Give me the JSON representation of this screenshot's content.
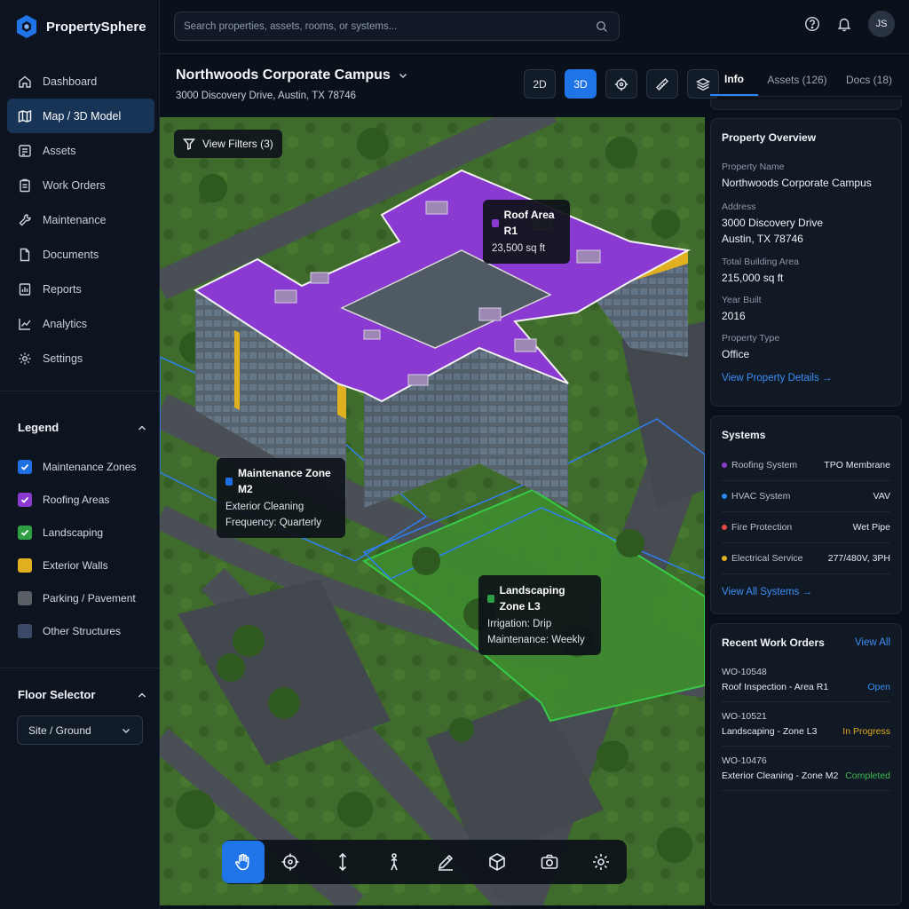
{
  "app": {
    "name": "PropertySphere"
  },
  "colors": {
    "accent": "#1f74e8",
    "roofing": "#8a3ad1",
    "maintenance": "#1e6fe0",
    "landscaping": "#2ea043",
    "exterior": "#e0b020",
    "parking": "#5a5f66",
    "other": "#3a4a66"
  },
  "nav": [
    {
      "label": "Dashboard",
      "icon": "home-icon"
    },
    {
      "label": "Map / 3D Model",
      "icon": "map-icon",
      "active": true
    },
    {
      "label": "Assets",
      "icon": "assets-icon"
    },
    {
      "label": "Work Orders",
      "icon": "work-orders-icon"
    },
    {
      "label": "Maintenance",
      "icon": "wrench-icon"
    },
    {
      "label": "Documents",
      "icon": "document-icon"
    },
    {
      "label": "Reports",
      "icon": "report-icon"
    },
    {
      "label": "Analytics",
      "icon": "analytics-icon"
    },
    {
      "label": "Settings",
      "icon": "gear-icon"
    }
  ],
  "legend": {
    "title": "Legend",
    "items": [
      {
        "label": "Maintenance Zones",
        "checked": true
      },
      {
        "label": "Roofing Areas",
        "checked": true
      },
      {
        "label": "Landscaping",
        "checked": true
      },
      {
        "label": "Exterior Walls",
        "checked": false
      },
      {
        "label": "Parking / Pavement",
        "checked": false
      },
      {
        "label": "Other Structures",
        "checked": false
      }
    ]
  },
  "floor": {
    "title": "Floor Selector",
    "selected": "Site / Ground"
  },
  "search": {
    "placeholder": "Search properties, assets, rooms, or systems..."
  },
  "user": {
    "initials": "JS"
  },
  "property": {
    "title": "Northwoods Corporate Campus",
    "address": "3000 Discovery Drive, Austin, TX 78746"
  },
  "toolbar": {
    "view_2d": "2D",
    "view_3d": "3D"
  },
  "tabs": [
    {
      "label": "Info"
    },
    {
      "label": "Assets (126)"
    },
    {
      "label": "Docs (18)"
    }
  ],
  "map": {
    "filters_label": "View Filters (3)",
    "tooltips": {
      "roof": {
        "title": "Roof Area R1",
        "line1": "23,500 sq ft"
      },
      "maint": {
        "title": "Maintenance Zone M2",
        "line1": "Exterior Cleaning",
        "line2": "Frequency: Quarterly"
      },
      "land": {
        "title": "Landscaping Zone L3",
        "line1": "Irrigation: Drip",
        "line2": "Maintenance: Weekly"
      }
    }
  },
  "overview": {
    "title": "Property Overview",
    "name_label": "Property Name",
    "name_value": "Northwoods Corporate Campus",
    "address_label": "Address",
    "address_line1": "3000 Discovery Drive",
    "address_line2": "Austin, TX 78746",
    "area_label": "Total Building Area",
    "area_value": "215,000 sq ft",
    "year_label": "Year Built",
    "year_value": "2016",
    "type_label": "Property Type",
    "type_value": "Office",
    "link": "View Property Details →"
  },
  "systems": {
    "title": "Systems",
    "rows": [
      {
        "name": "Roofing System",
        "value": "TPO Membrane",
        "color": "#8a3ad1"
      },
      {
        "name": "HVAC System",
        "value": "VAV",
        "color": "#2e86f5"
      },
      {
        "name": "Fire Protection",
        "value": "Wet Pipe",
        "color": "#e5483d"
      },
      {
        "name": "Electrical Service",
        "value": "277/480V, 3PH",
        "color": "#e0b020"
      }
    ],
    "link": "View All Systems →"
  },
  "work_orders": {
    "title": "Recent Work Orders",
    "view_all": "View All",
    "items": [
      {
        "id": "WO-10548",
        "desc": "Roof Inspection - Area R1",
        "status": "Open",
        "color": "#3b8ff5"
      },
      {
        "id": "WO-10521",
        "desc": "Landscaping - Zone L3",
        "status": "In Progress",
        "color": "#e0a820"
      },
      {
        "id": "WO-10476",
        "desc": "Exterior Cleaning - Zone M2",
        "status": "Completed",
        "color": "#3fb950"
      }
    ]
  }
}
